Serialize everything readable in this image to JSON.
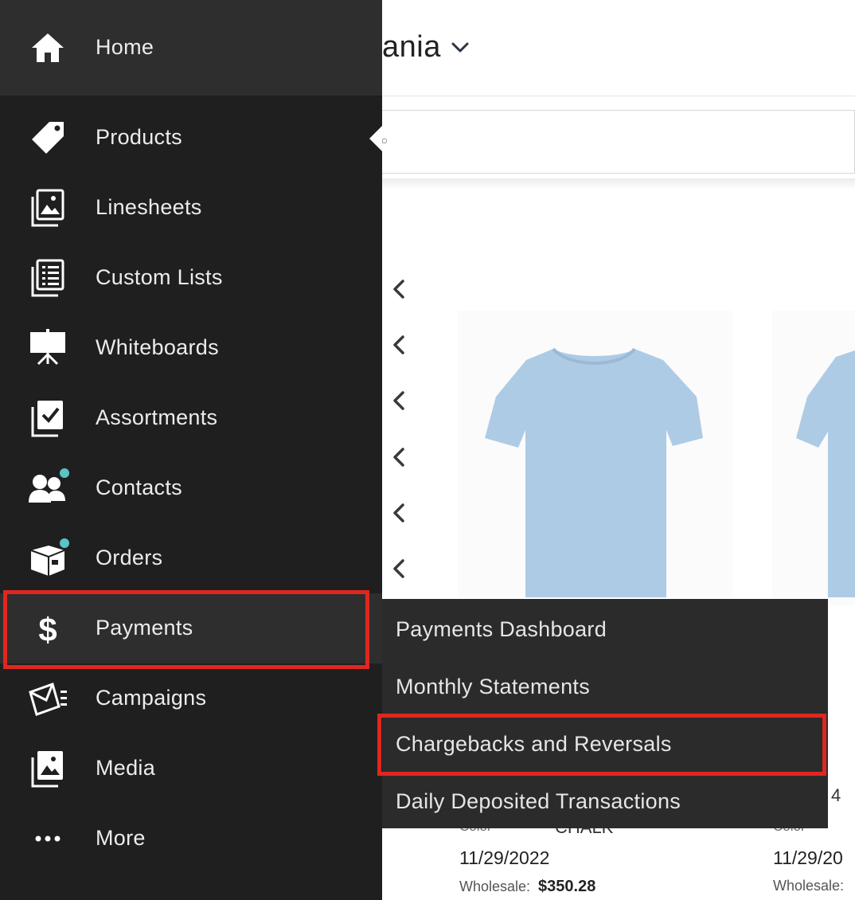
{
  "page": {
    "title_partial": "ania",
    "search_glyph": "⌕"
  },
  "products": [
    {
      "image": "light-blue-tshirt",
      "color_label": "Color",
      "color_value": "CHALK",
      "date": "11/29/2022",
      "wholesale_label": "Wholesale:",
      "wholesale_value": "$350.28"
    },
    {
      "image": "light-blue-tshirt",
      "color_label": "Color",
      "partial_number": "4",
      "date": "11/29/20",
      "wholesale_label": "Wholesale:"
    }
  ],
  "sidebar": {
    "items": [
      {
        "label": "Home",
        "icon": "home-icon"
      },
      {
        "label": "Products",
        "icon": "tag-icon"
      },
      {
        "label": "Linesheets",
        "icon": "linesheets-icon"
      },
      {
        "label": "Custom Lists",
        "icon": "list-icon"
      },
      {
        "label": "Whiteboards",
        "icon": "whiteboard-icon"
      },
      {
        "label": "Assortments",
        "icon": "assortments-icon"
      },
      {
        "label": "Contacts",
        "icon": "contacts-icon"
      },
      {
        "label": "Orders",
        "icon": "box-icon"
      },
      {
        "label": "Payments",
        "icon": "dollar-icon"
      },
      {
        "label": "Campaigns",
        "icon": "campaign-icon"
      },
      {
        "label": "Media",
        "icon": "media-icon"
      },
      {
        "label": "More",
        "icon": "more-icon"
      }
    ]
  },
  "submenu": {
    "items": [
      {
        "label": "Payments Dashboard"
      },
      {
        "label": "Monthly Statements"
      },
      {
        "label": "Chargebacks and Reversals"
      },
      {
        "label": "Daily Deposited Transactions"
      }
    ]
  },
  "colors": {
    "sidebar_bg": "#1f1f1f",
    "active_bg": "#2e2e2e",
    "submenu_bg": "#2b2b2b",
    "highlight": "#e0271f",
    "notification_dot": "#5bc4c4"
  }
}
